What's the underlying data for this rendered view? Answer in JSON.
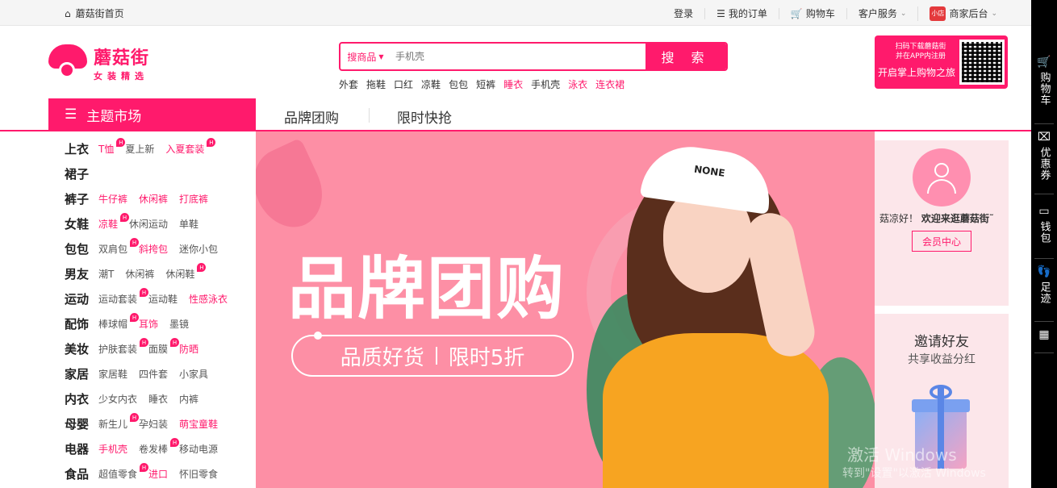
{
  "topbar": {
    "home": "蘑菇街首页",
    "login": "登录",
    "orders": "我的订单",
    "cart": "购物车",
    "service": "客户服务",
    "shop_badge": "小店",
    "merchant": "商家后台"
  },
  "logo": {
    "name": "蘑菇街",
    "tagline": "女装精选"
  },
  "search": {
    "category": "搜商品",
    "placeholder": "手机壳",
    "button": "搜 索"
  },
  "hotwords": [
    {
      "text": "外套",
      "hl": false
    },
    {
      "text": "拖鞋",
      "hl": false
    },
    {
      "text": "口红",
      "hl": false
    },
    {
      "text": "凉鞋",
      "hl": false
    },
    {
      "text": "包包",
      "hl": false
    },
    {
      "text": "短裤",
      "hl": false
    },
    {
      "text": "睡衣",
      "hl": true
    },
    {
      "text": "手机壳",
      "hl": false
    },
    {
      "text": "泳衣",
      "hl": true
    },
    {
      "text": "连衣裙",
      "hl": true
    }
  ],
  "qr": {
    "line1": "扫码下载蘑菇街",
    "line2": "并在APP内注册",
    "line3": "开启掌上购物之旅"
  },
  "nav": {
    "theme": "主题市场",
    "tab1": "品牌团购",
    "tab2": "限时快抢"
  },
  "categories": [
    {
      "name": "上衣",
      "subs": [
        {
          "t": "T恤",
          "hl": true,
          "b": true
        },
        {
          "t": "夏上新",
          "hl": false,
          "b": false
        },
        {
          "t": "入夏套装",
          "hl": true,
          "b": true
        }
      ]
    },
    {
      "name": "裙子",
      "subs": []
    },
    {
      "name": "裤子",
      "subs": [
        {
          "t": "牛仔裤",
          "hl": true,
          "b": false
        },
        {
          "t": "休闲裤",
          "hl": true,
          "b": false
        },
        {
          "t": "打底裤",
          "hl": true,
          "b": false
        }
      ]
    },
    {
      "name": "女鞋",
      "subs": [
        {
          "t": "凉鞋",
          "hl": true,
          "b": true
        },
        {
          "t": "休闲运动",
          "hl": false,
          "b": false
        },
        {
          "t": "单鞋",
          "hl": false,
          "b": false
        }
      ]
    },
    {
      "name": "包包",
      "subs": [
        {
          "t": "双肩包",
          "hl": false,
          "b": true
        },
        {
          "t": "斜挎包",
          "hl": true,
          "b": false
        },
        {
          "t": "迷你小包",
          "hl": false,
          "b": false
        }
      ]
    },
    {
      "name": "男友",
      "subs": [
        {
          "t": "潮T",
          "hl": false,
          "b": false
        },
        {
          "t": "休闲裤",
          "hl": false,
          "b": false
        },
        {
          "t": "休闲鞋",
          "hl": false,
          "b": true
        }
      ]
    },
    {
      "name": "运动",
      "subs": [
        {
          "t": "运动套装",
          "hl": false,
          "b": true
        },
        {
          "t": "运动鞋",
          "hl": false,
          "b": false
        },
        {
          "t": "性感泳衣",
          "hl": true,
          "b": false
        }
      ]
    },
    {
      "name": "配饰",
      "subs": [
        {
          "t": "棒球帽",
          "hl": false,
          "b": true
        },
        {
          "t": "耳饰",
          "hl": true,
          "b": false
        },
        {
          "t": "墨镜",
          "hl": false,
          "b": false
        }
      ]
    },
    {
      "name": "美妆",
      "subs": [
        {
          "t": "护肤套装",
          "hl": false,
          "b": true
        },
        {
          "t": "面膜",
          "hl": false,
          "b": true
        },
        {
          "t": "防晒",
          "hl": true,
          "b": false
        }
      ]
    },
    {
      "name": "家居",
      "subs": [
        {
          "t": "家居鞋",
          "hl": false,
          "b": false
        },
        {
          "t": "四件套",
          "hl": false,
          "b": false
        },
        {
          "t": "小家具",
          "hl": false,
          "b": false
        }
      ]
    },
    {
      "name": "内衣",
      "subs": [
        {
          "t": "少女内衣",
          "hl": false,
          "b": false
        },
        {
          "t": "睡衣",
          "hl": false,
          "b": false
        },
        {
          "t": "内裤",
          "hl": false,
          "b": false
        }
      ]
    },
    {
      "name": "母婴",
      "subs": [
        {
          "t": "新生儿",
          "hl": false,
          "b": true
        },
        {
          "t": "孕妇装",
          "hl": false,
          "b": false
        },
        {
          "t": "萌宝童鞋",
          "hl": true,
          "b": false
        }
      ]
    },
    {
      "name": "电器",
      "subs": [
        {
          "t": "手机壳",
          "hl": true,
          "b": false
        },
        {
          "t": "卷发棒",
          "hl": false,
          "b": true
        },
        {
          "t": "移动电源",
          "hl": false,
          "b": false
        }
      ]
    },
    {
      "name": "食品",
      "subs": [
        {
          "t": "超值零食",
          "hl": false,
          "b": true
        },
        {
          "t": "进口",
          "hl": true,
          "b": false
        },
        {
          "t": "怀旧零食",
          "hl": false,
          "b": false
        }
      ]
    }
  ],
  "banner": {
    "headline": "品牌团购",
    "pill_left": "品质好货",
    "pill_right": "限时5折",
    "cap_text": "NONE"
  },
  "user": {
    "greet": "菇凉好！",
    "welcome": "欢迎来逛蘑菇街˜",
    "member": "会员中心"
  },
  "invite": {
    "title": "邀请好友",
    "subtitle": "共享收益分红"
  },
  "watermark": {
    "line1": "激活 Windows",
    "line2": "转到\"设置\"以激活 Windows"
  },
  "rightbar": [
    {
      "icon": "cart-icon",
      "label": "购物车"
    },
    {
      "icon": "coupon-icon",
      "label": "优惠券"
    },
    {
      "icon": "wallet-icon",
      "label": "钱包"
    },
    {
      "icon": "footprint-icon",
      "label": "足迹"
    },
    {
      "icon": "grid-icon",
      "label": ""
    }
  ],
  "colors": {
    "brand": "#ff1a6c",
    "banner": "#fd8fa5"
  }
}
